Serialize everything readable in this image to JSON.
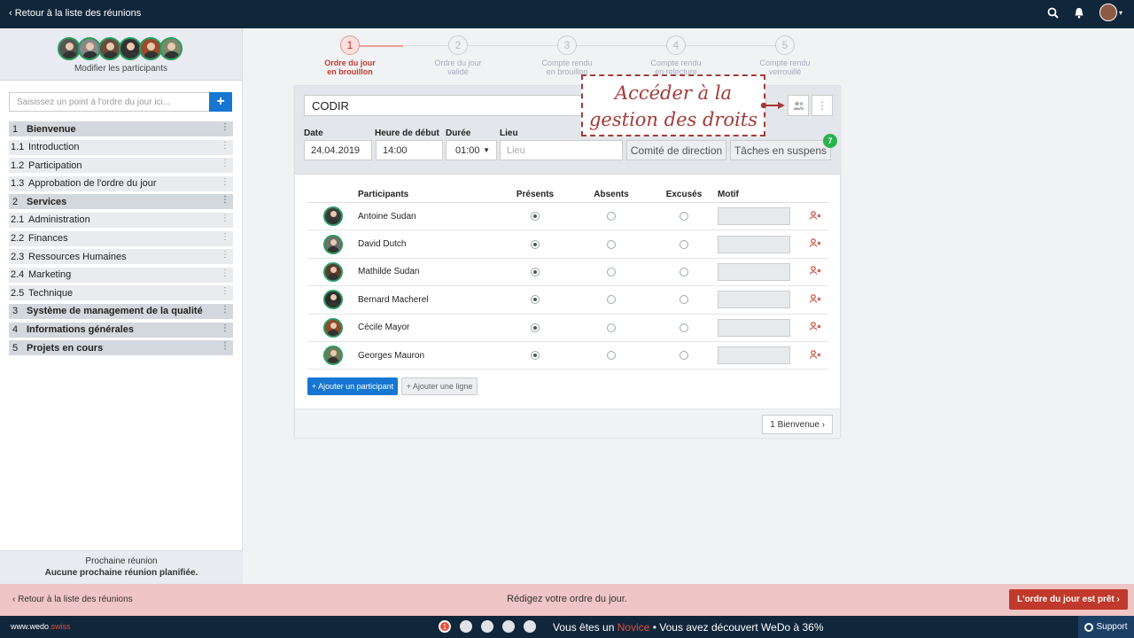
{
  "topbar": {
    "back_label": "‹ Retour à la liste des réunions"
  },
  "sidebar": {
    "edit_participants": "Modifier les participants",
    "agenda_placeholder": "Saisissez un point à l'ordre du jour ici...",
    "add_label": "+",
    "items": [
      {
        "num": "1",
        "label": "Bienvenue",
        "section": true
      },
      {
        "num": "1.1",
        "label": "Introduction",
        "section": false
      },
      {
        "num": "1.2",
        "label": "Participation",
        "section": false
      },
      {
        "num": "1.3",
        "label": "Approbation de l'ordre du jour",
        "section": false
      },
      {
        "num": "2",
        "label": "Services",
        "section": true
      },
      {
        "num": "2.1",
        "label": "Administration",
        "section": false
      },
      {
        "num": "2.2",
        "label": "Finances",
        "section": false
      },
      {
        "num": "2.3",
        "label": "Ressources Humaines",
        "section": false
      },
      {
        "num": "2.4",
        "label": "Marketing",
        "section": false
      },
      {
        "num": "2.5",
        "label": "Technique",
        "section": false
      },
      {
        "num": "3",
        "label": "Système de management de la qualité",
        "section": true
      },
      {
        "num": "4",
        "label": "Informations générales",
        "section": true
      },
      {
        "num": "5",
        "label": "Projets en cours",
        "section": true
      }
    ],
    "next_meeting_label": "Prochaine réunion",
    "next_meeting_value": "Aucune prochaine réunion planifiée."
  },
  "stepper": [
    {
      "num": "1",
      "line1": "Ordre du jour",
      "line2": "en brouillon"
    },
    {
      "num": "2",
      "line1": "Ordre du jour",
      "line2": "validé"
    },
    {
      "num": "3",
      "line1": "Compte rendu",
      "line2": "en brouillon"
    },
    {
      "num": "4",
      "line1": "Compte rendu",
      "line2": "en relecture"
    },
    {
      "num": "5",
      "line1": "Compte rendu",
      "line2": "verrouillé"
    }
  ],
  "meeting": {
    "title": "CODIR",
    "date_label": "Date",
    "date_value": "24.04.2019",
    "start_label": "Heure de début",
    "start_value": "14:00",
    "duration_label": "Durée",
    "duration_value": "01:00",
    "place_label": "Lieu",
    "place_placeholder": "Lieu",
    "committee_label": "Comité de direction",
    "pending_label": "Tâches en suspens",
    "pending_count": "7"
  },
  "annotation": {
    "line1": "Accéder à la",
    "line2": "gestion des droits"
  },
  "table": {
    "headers": {
      "participants": "Participants",
      "present": "Présents",
      "absent": "Absents",
      "excused": "Excusés",
      "reason": "Motif"
    },
    "rows": [
      {
        "name": "Antoine Sudan"
      },
      {
        "name": "David Dutch"
      },
      {
        "name": "Mathilde Sudan"
      },
      {
        "name": "Bernard Macherel"
      },
      {
        "name": "Cécile Mayor"
      },
      {
        "name": "Georges Mauron"
      }
    ],
    "add_participant": "+ Ajouter un participant",
    "add_line": "+ Ajouter une ligne",
    "next_label": "1 Bienvenue ›"
  },
  "statusbar": {
    "back_label": "‹  Retour à la liste des réunions",
    "message": "Rédigez votre ordre du jour.",
    "ready_label": "L'ordre du jour est prêt  ›"
  },
  "footer": {
    "brand_main": "www.wedo",
    "brand_accent": ".swiss",
    "dot_label": "1",
    "prog_prefix": "Vous êtes un ",
    "prog_level": "Novice",
    "prog_suffix": " • Vous avez découvert WeDo à 36%",
    "support_label": "Support"
  },
  "colors": {
    "navy": "#10263a",
    "accent_red": "#c0392b",
    "blue": "#1676d2",
    "green": "#2ab24f"
  }
}
